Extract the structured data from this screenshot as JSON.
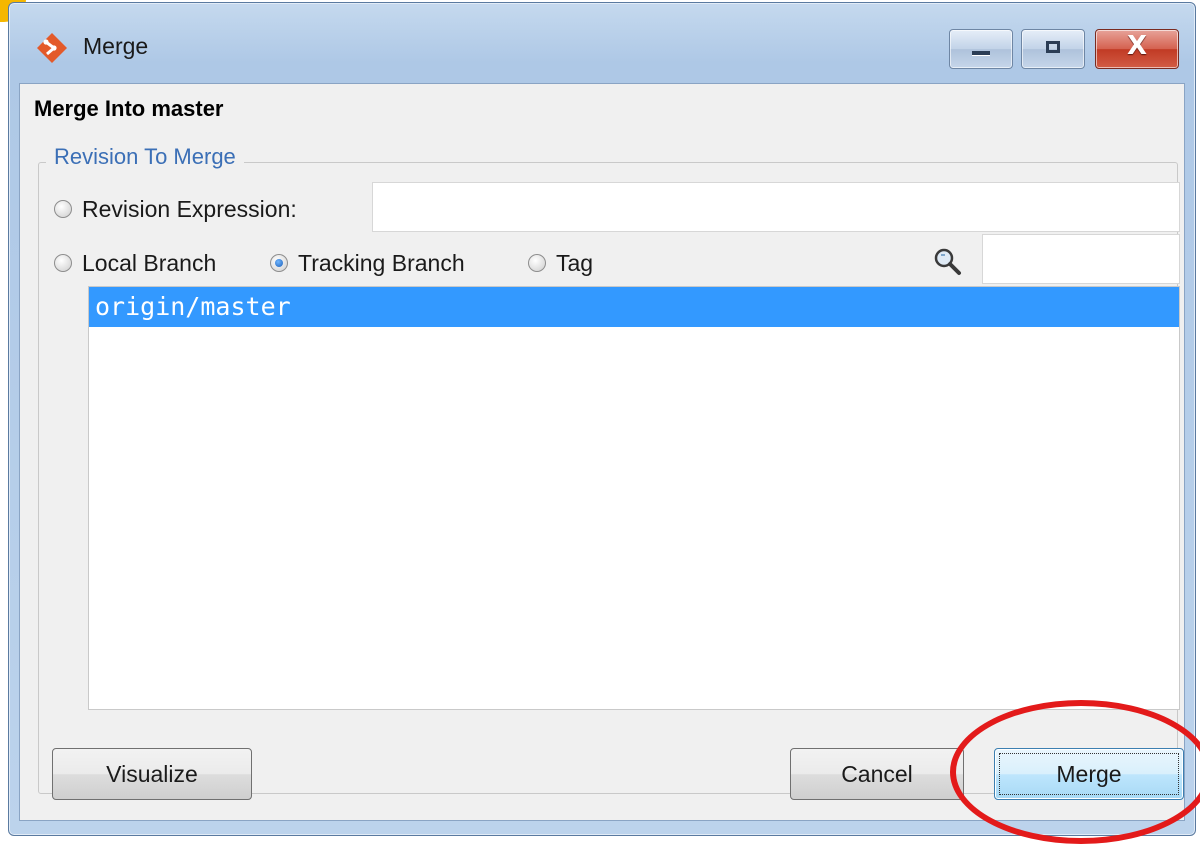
{
  "window": {
    "title": "Merge",
    "controls": {
      "minimize": "minimize",
      "maximize": "maximize",
      "close": "X"
    }
  },
  "header": {
    "title": "Merge Into master"
  },
  "revision_group": {
    "legend": "Revision To Merge",
    "revision_expression": {
      "label": "Revision Expression:",
      "value": "",
      "checked": false
    },
    "branch_type": {
      "options": [
        {
          "label": "Local Branch",
          "checked": false
        },
        {
          "label": "Tracking Branch",
          "checked": true
        },
        {
          "label": "Tag",
          "checked": false
        }
      ]
    },
    "filter": {
      "value": ""
    },
    "branches": [
      {
        "name": "origin/master",
        "selected": true
      }
    ]
  },
  "buttons": {
    "visualize": "Visualize",
    "cancel": "Cancel",
    "merge": "Merge"
  },
  "colors": {
    "selection": "#3399ff",
    "legend_text": "#3b6fb6",
    "annotation": "#e31a1a"
  },
  "icons": [
    "git-logo-icon",
    "search-icon"
  ]
}
